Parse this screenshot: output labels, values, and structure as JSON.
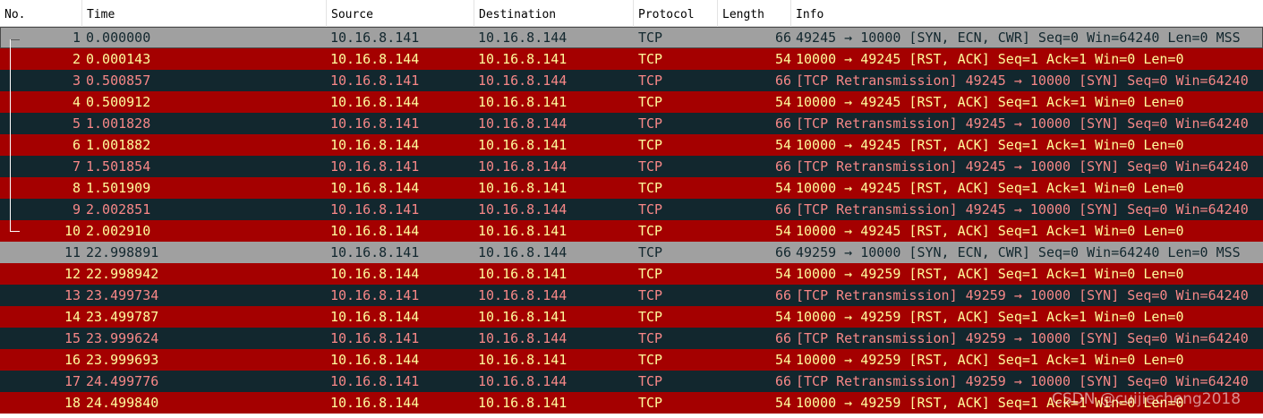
{
  "columns": {
    "no": "No.",
    "time": "Time",
    "source": "Source",
    "destination": "Destination",
    "protocol": "Protocol",
    "length": "Length",
    "info": "Info"
  },
  "colors": {
    "syn_row_bg": "#a0a0a0",
    "rst_row_bg": "#a40000",
    "retrans_row_bg": "#12272e",
    "rst_row_fg": "#fffc9c",
    "retrans_row_fg": "#f78787"
  },
  "packets": [
    {
      "no": "1",
      "time": "0.000000",
      "source": "10.16.8.141",
      "destination": "10.16.8.144",
      "protocol": "TCP",
      "length": "66",
      "info": "49245 → 10000 [SYN, ECN, CWR] Seq=0 Win=64240 Len=0 MSS",
      "kind": "syn"
    },
    {
      "no": "2",
      "time": "0.000143",
      "source": "10.16.8.144",
      "destination": "10.16.8.141",
      "protocol": "TCP",
      "length": "54",
      "info": "10000 → 49245 [RST, ACK] Seq=1 Ack=1 Win=0 Len=0",
      "kind": "rst"
    },
    {
      "no": "3",
      "time": "0.500857",
      "source": "10.16.8.141",
      "destination": "10.16.8.144",
      "protocol": "TCP",
      "length": "66",
      "info": "[TCP Retransmission] 49245 → 10000 [SYN] Seq=0 Win=64240",
      "kind": "retrans"
    },
    {
      "no": "4",
      "time": "0.500912",
      "source": "10.16.8.144",
      "destination": "10.16.8.141",
      "protocol": "TCP",
      "length": "54",
      "info": "10000 → 49245 [RST, ACK] Seq=1 Ack=1 Win=0 Len=0",
      "kind": "rst"
    },
    {
      "no": "5",
      "time": "1.001828",
      "source": "10.16.8.141",
      "destination": "10.16.8.144",
      "protocol": "TCP",
      "length": "66",
      "info": "[TCP Retransmission] 49245 → 10000 [SYN] Seq=0 Win=64240",
      "kind": "retrans"
    },
    {
      "no": "6",
      "time": "1.001882",
      "source": "10.16.8.144",
      "destination": "10.16.8.141",
      "protocol": "TCP",
      "length": "54",
      "info": "10000 → 49245 [RST, ACK] Seq=1 Ack=1 Win=0 Len=0",
      "kind": "rst"
    },
    {
      "no": "7",
      "time": "1.501854",
      "source": "10.16.8.141",
      "destination": "10.16.8.144",
      "protocol": "TCP",
      "length": "66",
      "info": "[TCP Retransmission] 49245 → 10000 [SYN] Seq=0 Win=64240",
      "kind": "retrans"
    },
    {
      "no": "8",
      "time": "1.501909",
      "source": "10.16.8.144",
      "destination": "10.16.8.141",
      "protocol": "TCP",
      "length": "54",
      "info": "10000 → 49245 [RST, ACK] Seq=1 Ack=1 Win=0 Len=0",
      "kind": "rst"
    },
    {
      "no": "9",
      "time": "2.002851",
      "source": "10.16.8.141",
      "destination": "10.16.8.144",
      "protocol": "TCP",
      "length": "66",
      "info": "[TCP Retransmission] 49245 → 10000 [SYN] Seq=0 Win=64240",
      "kind": "retrans"
    },
    {
      "no": "10",
      "time": "2.002910",
      "source": "10.16.8.144",
      "destination": "10.16.8.141",
      "protocol": "TCP",
      "length": "54",
      "info": "10000 → 49245 [RST, ACK] Seq=1 Ack=1 Win=0 Len=0",
      "kind": "rst"
    },
    {
      "no": "11",
      "time": "22.998891",
      "source": "10.16.8.141",
      "destination": "10.16.8.144",
      "protocol": "TCP",
      "length": "66",
      "info": "49259 → 10000 [SYN, ECN, CWR] Seq=0 Win=64240 Len=0 MSS",
      "kind": "syn"
    },
    {
      "no": "12",
      "time": "22.998942",
      "source": "10.16.8.144",
      "destination": "10.16.8.141",
      "protocol": "TCP",
      "length": "54",
      "info": "10000 → 49259 [RST, ACK] Seq=1 Ack=1 Win=0 Len=0",
      "kind": "rst"
    },
    {
      "no": "13",
      "time": "23.499734",
      "source": "10.16.8.141",
      "destination": "10.16.8.144",
      "protocol": "TCP",
      "length": "66",
      "info": "[TCP Retransmission] 49259 → 10000 [SYN] Seq=0 Win=64240",
      "kind": "retrans"
    },
    {
      "no": "14",
      "time": "23.499787",
      "source": "10.16.8.144",
      "destination": "10.16.8.141",
      "protocol": "TCP",
      "length": "54",
      "info": "10000 → 49259 [RST, ACK] Seq=1 Ack=1 Win=0 Len=0",
      "kind": "rst"
    },
    {
      "no": "15",
      "time": "23.999624",
      "source": "10.16.8.141",
      "destination": "10.16.8.144",
      "protocol": "TCP",
      "length": "66",
      "info": "[TCP Retransmission] 49259 → 10000 [SYN] Seq=0 Win=64240",
      "kind": "retrans"
    },
    {
      "no": "16",
      "time": "23.999693",
      "source": "10.16.8.144",
      "destination": "10.16.8.141",
      "protocol": "TCP",
      "length": "54",
      "info": "10000 → 49259 [RST, ACK] Seq=1 Ack=1 Win=0 Len=0",
      "kind": "rst"
    },
    {
      "no": "17",
      "time": "24.499776",
      "source": "10.16.8.141",
      "destination": "10.16.8.144",
      "protocol": "TCP",
      "length": "66",
      "info": "[TCP Retransmission] 49259 → 10000 [SYN] Seq=0 Win=64240",
      "kind": "retrans"
    },
    {
      "no": "18",
      "time": "24.499840",
      "source": "10.16.8.144",
      "destination": "10.16.8.141",
      "protocol": "TCP",
      "length": "54",
      "info": "10000 → 49259 [RST, ACK] Seq=1 Ack=1 Win=0 Len=0",
      "kind": "rst"
    }
  ],
  "watermark": "CSDN @cuijiecheng2018"
}
